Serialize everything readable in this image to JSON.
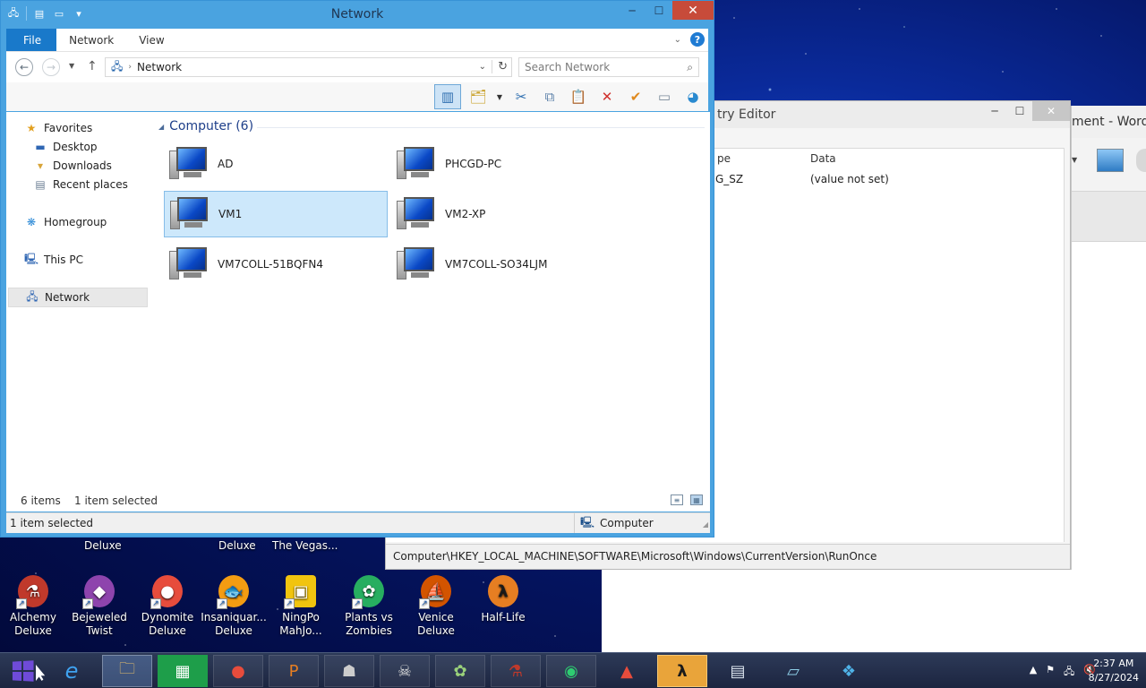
{
  "word": {
    "title_fragment": "ment - Word"
  },
  "regedit": {
    "title_fragment": "try Editor",
    "col_type_fragment": "pe",
    "col_data": "Data",
    "row_type_fragment": "G_SZ",
    "row_data": "(value not set)",
    "status_path": "Computer\\HKEY_LOCAL_MACHINE\\SOFTWARE\\Microsoft\\Windows\\CurrentVersion\\RunOnce"
  },
  "explorer": {
    "title": "Network",
    "tabs": {
      "file": "File",
      "network": "Network",
      "view": "View"
    },
    "help": "?",
    "address": {
      "path": "Network"
    },
    "search": {
      "placeholder": "Search Network"
    },
    "nav": {
      "favorites": "Favorites",
      "desktop": "Desktop",
      "downloads": "Downloads",
      "recent": "Recent places",
      "homegroup": "Homegroup",
      "thispc": "This PC",
      "network": "Network"
    },
    "group": {
      "label": "Computer (6)"
    },
    "computers": [
      "AD",
      "PHCGD-PC",
      "VM1",
      "VM2-XP",
      "VM7COLL-51BQFN4",
      "VM7COLL-SO34LJM"
    ],
    "selected_computer": "VM1",
    "status": {
      "items": "6 items",
      "selected": "1 item selected"
    },
    "bottom": {
      "selected": "1 item selected",
      "zone": "Computer"
    }
  },
  "desktop": {
    "partial_labels": [
      "Deluxe",
      "Deluxe",
      "The Vegas..."
    ],
    "icons": [
      {
        "line1": "Alchemy",
        "line2": "Deluxe",
        "icon": "alchemy-icon",
        "color": "#c0392b"
      },
      {
        "line1": "Bejeweled",
        "line2": "Twist",
        "icon": "bejeweled-icon",
        "color": "#8e44ad"
      },
      {
        "line1": "Dynomite",
        "line2": "Deluxe",
        "icon": "dynomite-icon",
        "color": "#e74c3c"
      },
      {
        "line1": "Insaniquar...",
        "line2": "Deluxe",
        "icon": "insaniquarium-icon",
        "color": "#f39c12"
      },
      {
        "line1": "NingPo",
        "line2": "MahJo...",
        "icon": "ningpo-icon",
        "color": "#f1c40f"
      },
      {
        "line1": "Plants vs",
        "line2": "Zombies",
        "icon": "plants-vs-zombies-icon",
        "color": "#27ae60"
      },
      {
        "line1": "Venice",
        "line2": "Deluxe",
        "icon": "venice-icon",
        "color": "#d35400"
      },
      {
        "line1": "Half-Life",
        "line2": "",
        "icon": "half-life-icon",
        "color": "#e67e22"
      }
    ]
  },
  "taskbar": {
    "time": "2:37 AM",
    "date": "8/27/2024"
  }
}
